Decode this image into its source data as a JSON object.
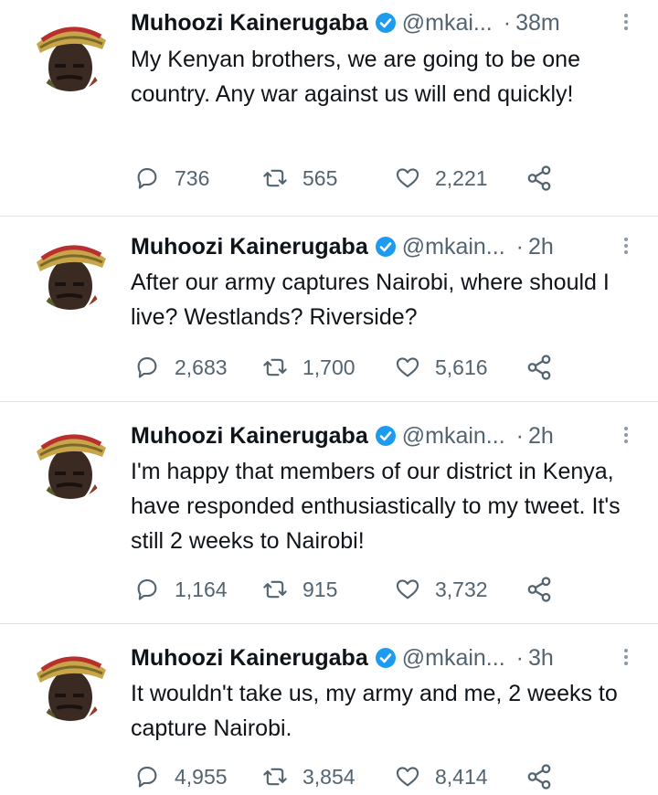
{
  "tweets": [
    {
      "name": "Muhoozi Kainerugaba",
      "handle": "@mkai...",
      "time": "38m",
      "text": "My Kenyan brothers, we are going to be one country. Any war against us will end quickly!",
      "replies": "736",
      "retweets": "565",
      "likes": "2,221"
    },
    {
      "name": "Muhoozi Kainerugaba",
      "handle": "@mkain...",
      "time": "2h",
      "text": "After our army captures Nairobi, where should I live? Westlands? Riverside?",
      "replies": "2,683",
      "retweets": "1,700",
      "likes": "5,616"
    },
    {
      "name": "Muhoozi Kainerugaba",
      "handle": "@mkain...",
      "time": "2h",
      "text": "I'm happy that members of our district in Kenya, have responded enthusiastically to my tweet. It's still 2 weeks to Nairobi!",
      "replies": "1,164",
      "retweets": "915",
      "likes": "3,732"
    },
    {
      "name": "Muhoozi Kainerugaba",
      "handle": "@mkain...",
      "time": "3h",
      "text": "It wouldn't take us, my army and me, 2 weeks to capture Nairobi.",
      "replies": "4,955",
      "retweets": "3,854",
      "likes": "8,414"
    }
  ],
  "colors": {
    "verified": "#1d9bf0",
    "muted": "#536471",
    "text": "#0f1419",
    "divider": "#dfe3e6"
  },
  "icons": [
    "verified-badge-icon",
    "more-options-icon",
    "reply-icon",
    "retweet-icon",
    "like-icon",
    "share-icon"
  ]
}
